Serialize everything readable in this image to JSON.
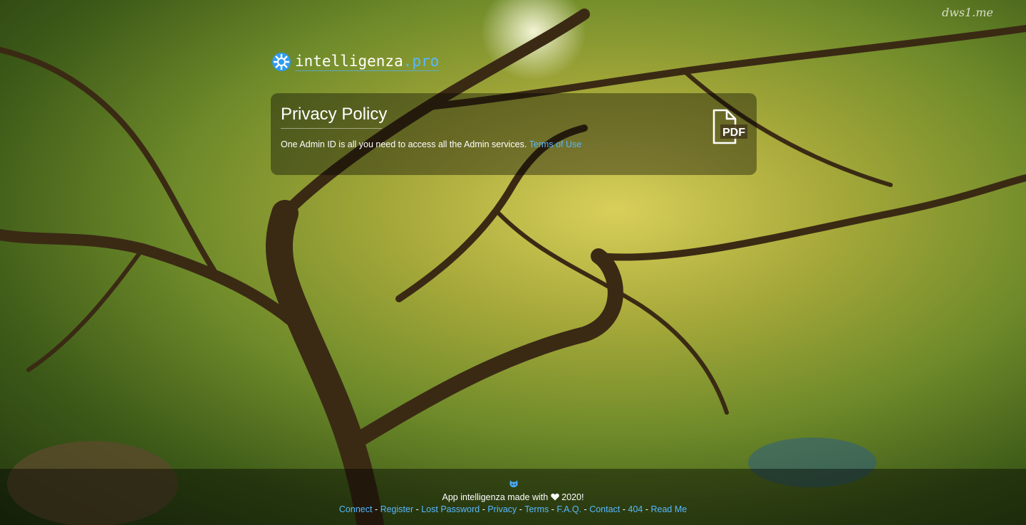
{
  "watermark": "dws1.me",
  "logo": {
    "name": "intelligenza",
    "tld": ".pro"
  },
  "card": {
    "title": "Privacy Policy",
    "body": "One Admin ID is all you need to access all the Admin services.",
    "terms_link": "Terms of Use",
    "pdf_icon": "pdf-file-icon",
    "pdf_label": "PDF"
  },
  "footer": {
    "icon": "github-octocat-icon",
    "made_prefix": "App intelligenza made with",
    "heart_icon": "heart-icon",
    "year": "2020!",
    "links": [
      "Connect",
      "Register",
      "Lost Password",
      "Privacy",
      "Terms",
      "F.A.Q.",
      "Contact",
      "404",
      "Read Me"
    ],
    "separator": " - "
  },
  "colors": {
    "link": "#58b8ff",
    "card_bg": "rgba(0,0,0,0.38)"
  }
}
